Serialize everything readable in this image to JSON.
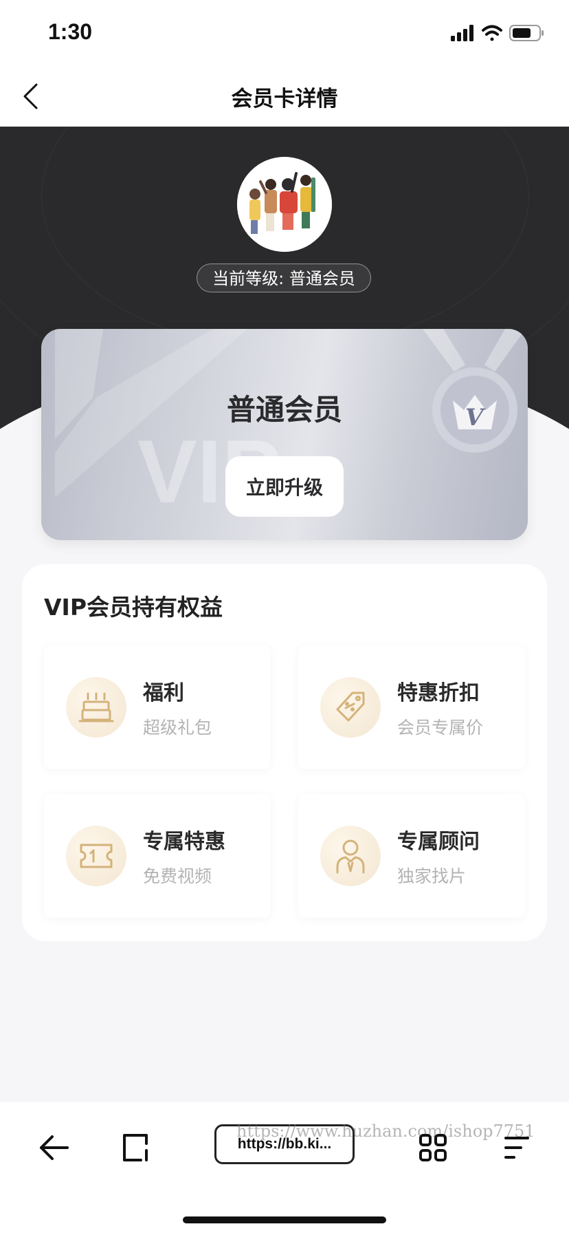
{
  "status_bar": {
    "time": "1:30"
  },
  "nav": {
    "title": "会员卡详情"
  },
  "profile": {
    "level_text": "当前等级: 普通会员"
  },
  "member_card": {
    "level_name": "普通会员",
    "upgrade_label": "立即升级",
    "watermark_text": "VIP"
  },
  "benefits": {
    "title": "VIP会员持有权益",
    "items": [
      {
        "name": "福利",
        "desc": "超级礼包",
        "icon": "cake-icon"
      },
      {
        "name": "特惠折扣",
        "desc": "会员专属价",
        "icon": "discount-tag-icon"
      },
      {
        "name": "专属特惠",
        "desc": "免费视频",
        "icon": "ticket-icon"
      },
      {
        "name": "专属顾问",
        "desc": "独家找片",
        "icon": "advisor-icon"
      }
    ]
  },
  "browser_bar": {
    "url": "https://bb.ki...",
    "watermark": "https://www.huzhan.com/ishop7751"
  },
  "colors": {
    "hero_bg": "#2a2a2c",
    "gold_accent": "#d4b27a",
    "card_silver": "#d4d6de"
  }
}
